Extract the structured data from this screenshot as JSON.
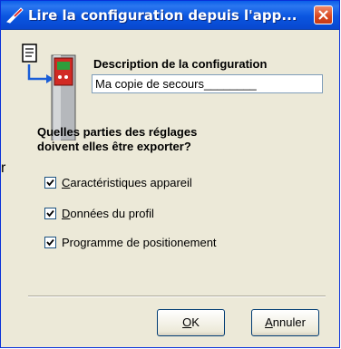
{
  "window": {
    "title": "Lire la configuration depuis l'app..."
  },
  "description": {
    "label": "Description de la configuration",
    "value": "Ma copie de secours________"
  },
  "question": {
    "line1": "Quelles parties des réglages",
    "line2": "doivent elles être exporter?"
  },
  "options": [
    {
      "first": "C",
      "rest": "aractéristiques appareil",
      "checked": true
    },
    {
      "first": "D",
      "rest": "onnées du profil",
      "checked": true
    },
    {
      "first": "",
      "rest": "Programme de positionement",
      "checked": true
    }
  ],
  "stray_text": "r",
  "buttons": {
    "ok_first": "O",
    "ok_rest": "K",
    "cancel_first": "A",
    "cancel_rest": "nnuler"
  },
  "colors": {
    "titlebar": "#0a55e0",
    "close_button": "#d8471e",
    "dialog_bg": "#ece9d8"
  }
}
